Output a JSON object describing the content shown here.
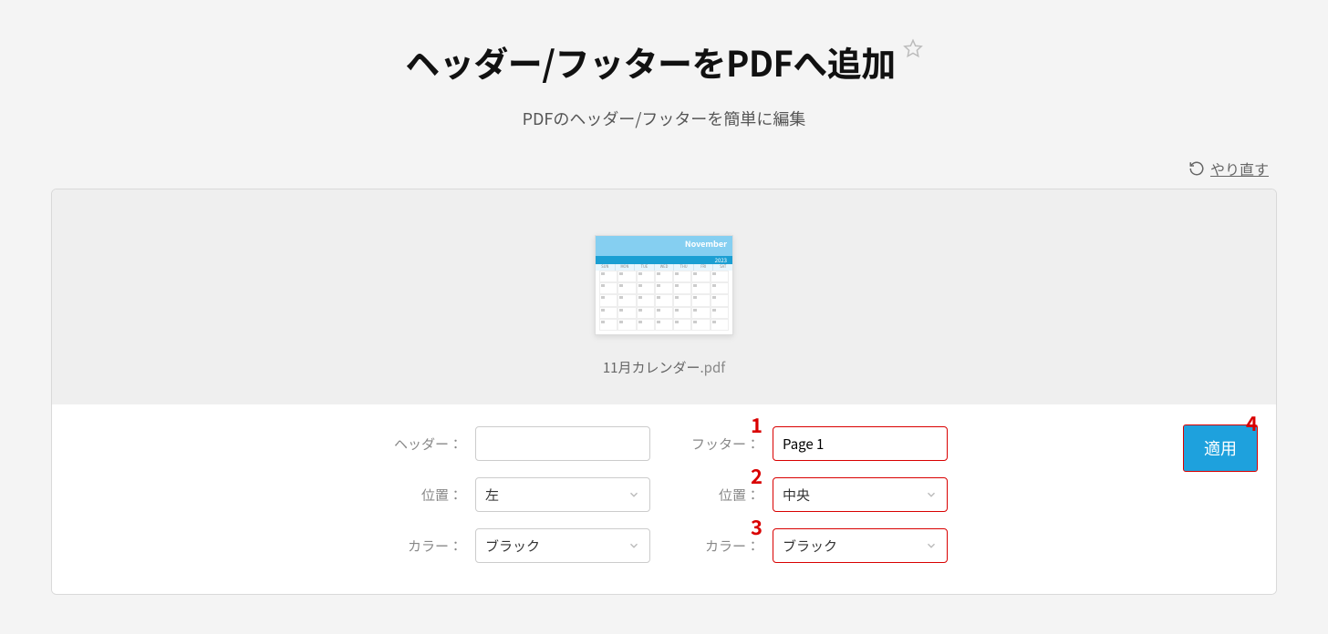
{
  "page": {
    "title": "ヘッダー/フッターをPDFへ追加",
    "subtitle": "PDFのヘッダー/フッターを簡単に編集"
  },
  "actions": {
    "redo": "やり直す",
    "apply": "適用"
  },
  "file": {
    "name": "11月カレンダー",
    "ext": ".pdf"
  },
  "thumb": {
    "month": "November",
    "year": "2023",
    "days": [
      "SUN",
      "MON",
      "TUE",
      "WED",
      "THU",
      "FRI",
      "SAT"
    ]
  },
  "left": {
    "header_label": "ヘッダー：",
    "header_value": "",
    "position_label": "位置：",
    "position_value": "左",
    "color_label": "カラー：",
    "color_value": "ブラック"
  },
  "right": {
    "footer_label": "フッター：",
    "footer_value": "Page 1",
    "position_label": "位置：",
    "position_value": "中央",
    "color_label": "カラー：",
    "color_value": "ブラック"
  },
  "steps": {
    "s1": "1",
    "s2": "2",
    "s3": "3",
    "s4": "4"
  }
}
